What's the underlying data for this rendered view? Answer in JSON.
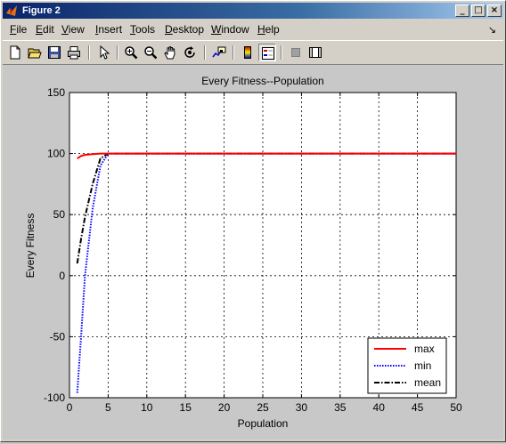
{
  "window": {
    "title": "Figure 2",
    "controls": [
      "_",
      "□",
      "×"
    ]
  },
  "menu": {
    "items": [
      {
        "u": "F",
        "rest": "ile"
      },
      {
        "u": "E",
        "rest": "dit"
      },
      {
        "u": "V",
        "rest": "iew"
      },
      {
        "u": "I",
        "rest": "nsert"
      },
      {
        "u": "T",
        "rest": "ools"
      },
      {
        "u": "D",
        "rest": "esktop"
      },
      {
        "u": "W",
        "rest": "indow"
      },
      {
        "u": "H",
        "rest": "elp"
      }
    ],
    "dock_arrow": "↘"
  },
  "toolbar": {
    "icons": [
      "new-figure-icon",
      "open-file-icon",
      "save-icon",
      "print-icon",
      "edit-plot-arrow-icon",
      "zoom-in-icon",
      "zoom-out-icon",
      "pan-hand-icon",
      "rotate-3d-icon",
      "data-cursor-icon",
      "colorbar-icon",
      "legend-icon",
      "hide-plot-tools-icon",
      "show-plot-tools-icon"
    ]
  },
  "chart_data": {
    "type": "line",
    "title": "Every Fitness--Population",
    "xlabel": "Population",
    "ylabel": "Every Fitness",
    "xlim": [
      0,
      50
    ],
    "ylim": [
      -100,
      150
    ],
    "xticks": [
      0,
      5,
      10,
      15,
      20,
      25,
      30,
      35,
      40,
      45,
      50
    ],
    "yticks": [
      -100,
      -50,
      0,
      50,
      100,
      150
    ],
    "grid": true,
    "legend_position": "bottom-right",
    "series": [
      {
        "name": "max",
        "color": "#ff0000",
        "dash": "solid",
        "x": [
          1,
          1.5,
          2,
          3,
          4,
          5,
          10,
          20,
          30,
          40,
          50
        ],
        "y": [
          96,
          98,
          99,
          99.5,
          100,
          100,
          100,
          100,
          100,
          100,
          100
        ]
      },
      {
        "name": "min",
        "color": "#0000ff",
        "dash": "dotted",
        "x": [
          1,
          1.5,
          2,
          3,
          4,
          5,
          10,
          20,
          30,
          40,
          50
        ],
        "y": [
          -96,
          -50,
          0,
          55,
          90,
          100,
          100,
          100,
          100,
          100,
          100
        ]
      },
      {
        "name": "mean",
        "color": "#000000",
        "dash": "dashdot",
        "x": [
          1,
          1.5,
          2,
          3,
          4,
          4.5,
          5,
          10,
          20,
          30,
          40,
          50
        ],
        "y": [
          10,
          30,
          48,
          75,
          96,
          98,
          100,
          100,
          100,
          100,
          100,
          100
        ]
      }
    ]
  }
}
